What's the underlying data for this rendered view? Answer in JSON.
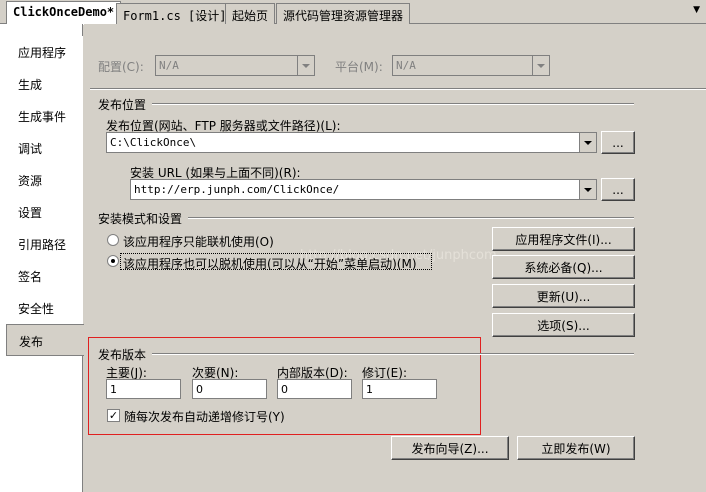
{
  "tabs": [
    {
      "label": "ClickOnceDemo*"
    },
    {
      "label": "Form1.cs [设计]"
    },
    {
      "label": "起始页"
    },
    {
      "label": "源代码管理资源管理器"
    }
  ],
  "tab_menu_icon": "▼",
  "sidebar": {
    "items": [
      {
        "label": "应用程序"
      },
      {
        "label": "生成"
      },
      {
        "label": "生成事件"
      },
      {
        "label": "调试"
      },
      {
        "label": "资源"
      },
      {
        "label": "设置"
      },
      {
        "label": "引用路径"
      },
      {
        "label": "签名"
      },
      {
        "label": "安全性"
      },
      {
        "label": "发布"
      }
    ],
    "active": "发布"
  },
  "config": {
    "config_label": "配置(C):",
    "config_value": "N/A",
    "platform_label": "平台(M):",
    "platform_value": "N/A"
  },
  "publish_location": {
    "section_title": "发布位置",
    "location_label": "发布位置(网站、FTP 服务器或文件路径)(L):",
    "location_value": "C:\\ClickOnce\\",
    "browse": "...",
    "install_url_label": "安装 URL (如果与上面不同)(R):",
    "install_url_value": "http://erp.junph.com/ClickOnce/"
  },
  "install_mode": {
    "section_title": "安装模式和设置",
    "online_only": "该应用程序只能联机使用(O)",
    "offline": "该应用程序也可以脱机使用(可以从“开始”菜单启动)(M)",
    "buttons": {
      "app_files": "应用程序文件(I)...",
      "prerequisites": "系统必备(Q)...",
      "updates": "更新(U)...",
      "options": "选项(S)..."
    }
  },
  "watermark": "http://blog.csdn.net/junphcom",
  "publish_version": {
    "section_title": "发布版本",
    "major_label": "主要(J):",
    "minor_label": "次要(N):",
    "build_label": "内部版本(D):",
    "revision_label": "修订(E):",
    "major": "1",
    "minor": "0",
    "build": "0",
    "revision": "1",
    "auto_increment": "随每次发布自动递增修订号(Y)",
    "auto_increment_checked": true
  },
  "actions": {
    "wizard": "发布向导(Z)...",
    "publish_now": "立即发布(W)"
  }
}
